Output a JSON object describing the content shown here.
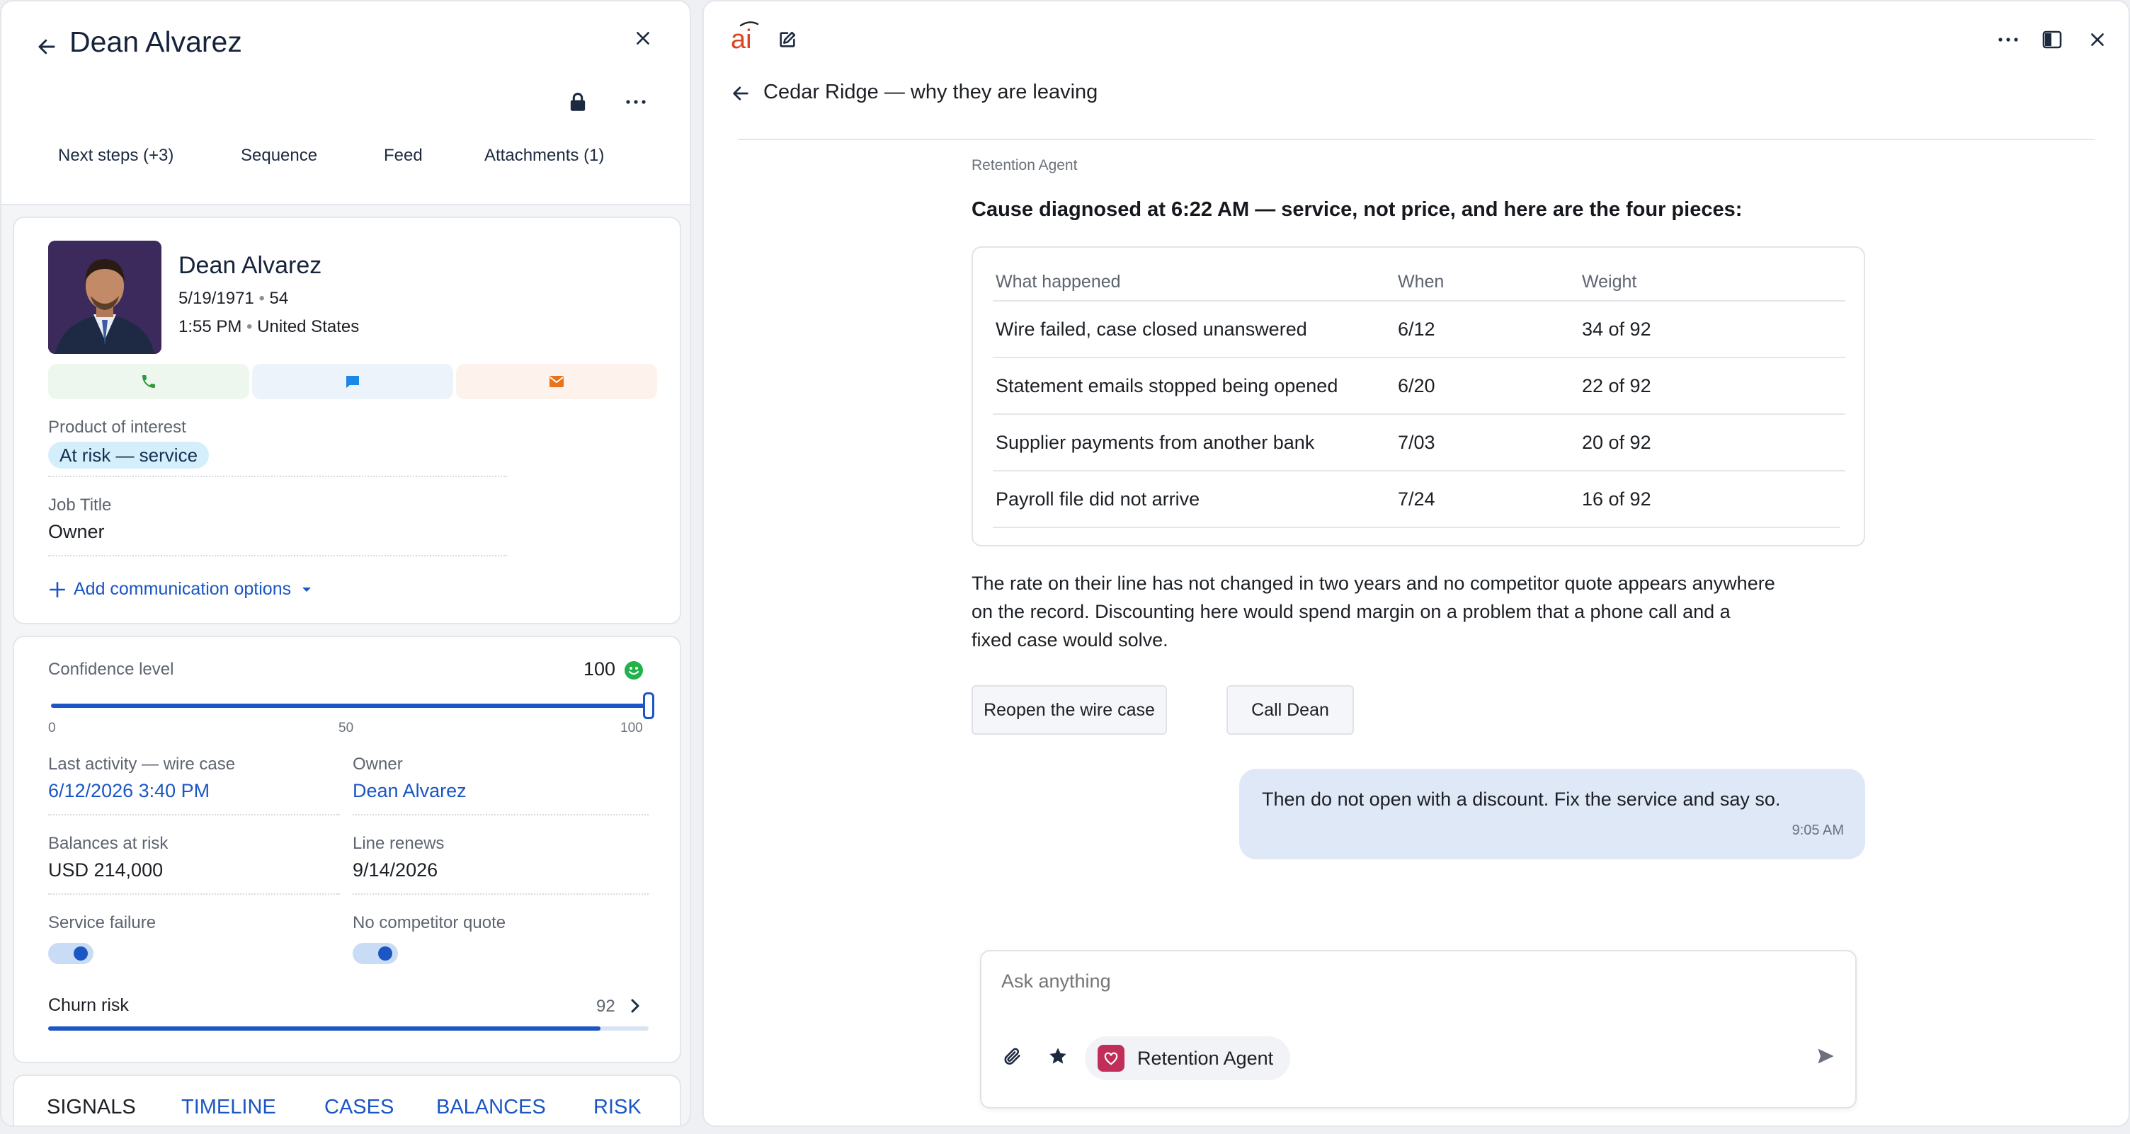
{
  "left": {
    "header_title": "Dean Alvarez",
    "tabs": [
      "Next steps (+3)",
      "Sequence",
      "Feed",
      "Attachments (1)"
    ],
    "contact": {
      "name": "Dean Alvarez",
      "dob": "5/19/1971",
      "age": "54",
      "time": "1:55 PM",
      "country": "United States"
    },
    "fields": {
      "product_label": "Product of interest",
      "product_value": "At risk — service",
      "job_label": "Job Title",
      "job_value": "Owner",
      "add_comm": "Add communication options"
    },
    "metrics": {
      "confidence_label": "Confidence level",
      "confidence_value": "100",
      "confidence_level": 1.0,
      "slider_ticks": [
        "0",
        "50",
        "100"
      ],
      "last_activity_label": "Last activity — wire case",
      "last_activity_value": "6/12/2026 3:40 PM",
      "owner_label": "Owner",
      "owner_value": "Dean Alvarez",
      "balances_label": "Balances at risk",
      "balances_value": "USD 214,000",
      "renews_label": "Line renews",
      "renews_value": "9/14/2026",
      "service_failure_label": "Service failure",
      "no_competitor_label": "No competitor quote",
      "churn_label": "Churn risk",
      "churn_value": "92",
      "churn_level": 0.92
    },
    "bottom_tabs": [
      "SIGNALS",
      "TIMELINE",
      "CASES",
      "BALANCES",
      "RISK"
    ]
  },
  "right": {
    "logo_text": "ai",
    "thread_title": "Cedar Ridge — why they are leaving",
    "agent_label": "Retention Agent",
    "headline": "Cause diagnosed at 6:22 AM — service, not price, and here are the four pieces:",
    "table": {
      "headers": [
        "What happened",
        "When",
        "Weight"
      ],
      "rows": [
        {
          "what": "Wire failed, case closed unanswered",
          "when": "6/12",
          "weight": "34 of 92"
        },
        {
          "what": "Statement emails stopped being opened",
          "when": "6/20",
          "weight": "22 of 92"
        },
        {
          "what": "Supplier payments from another bank",
          "when": "7/03",
          "weight": "20 of 92"
        },
        {
          "what": "Payroll file did not arrive",
          "when": "7/24",
          "weight": "16 of 92"
        }
      ]
    },
    "para": {
      "line1": "The rate on their line has not changed in two years and no competitor quote appears anywhere",
      "line2": "on the record. Discounting here would spend margin on a problem that a phone call and a",
      "line3": "fixed case would solve."
    },
    "suggestions": [
      "Reopen the wire case",
      "Call Dean"
    ],
    "user_message": "Then do not open with a discount. Fix the service and say so.",
    "user_time": "9:05 AM",
    "composer_placeholder": "Ask anything",
    "agent_chip": "Retention Agent"
  },
  "colors": {
    "accent": "#1a56c4",
    "phone_green": "#2e9a3c",
    "chat_blue": "#1b87e6",
    "mail_orange": "#e8731c",
    "logo_red": "#e0421f",
    "agent_chip": "#c22e5a",
    "bubble": "#dfe8f7"
  }
}
